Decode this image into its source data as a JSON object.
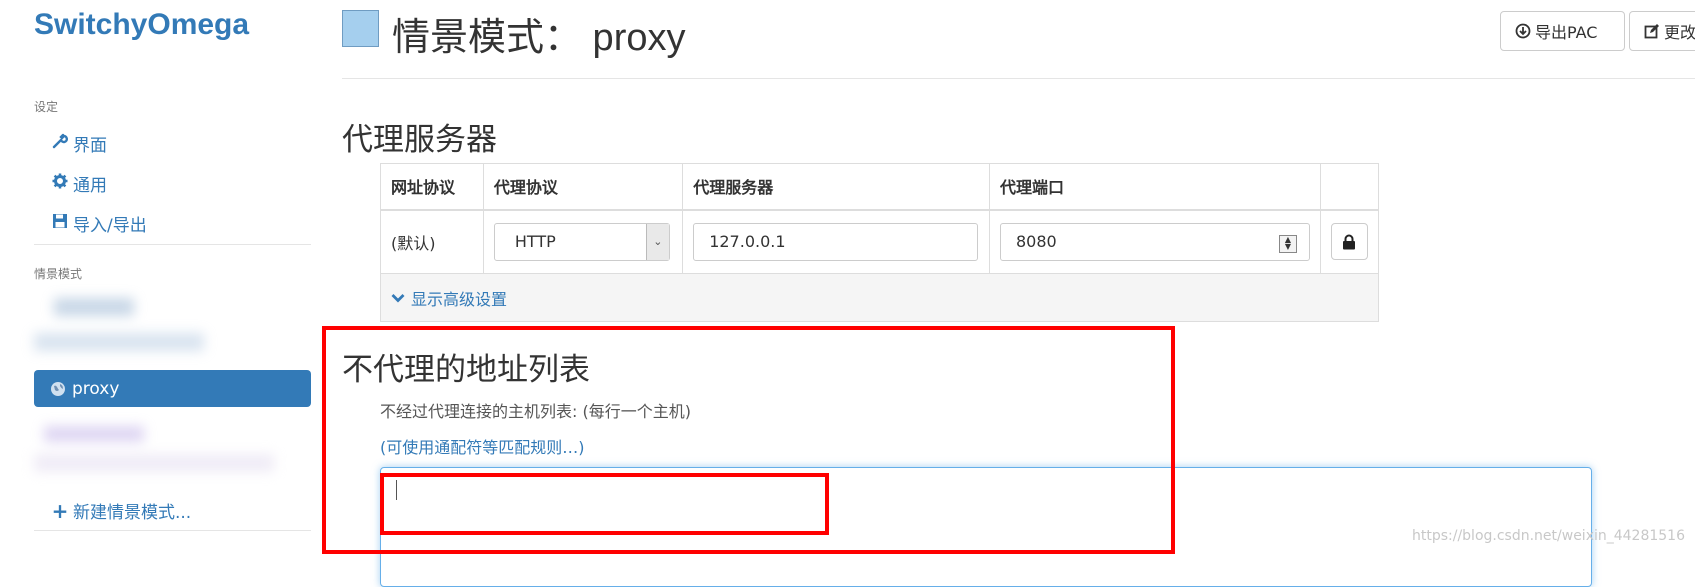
{
  "app": {
    "brand": "SwitchyOmega"
  },
  "sidebar": {
    "settings_header": "设定",
    "settings_items": [
      {
        "label": "界面",
        "icon": "wrench-icon"
      },
      {
        "label": "通用",
        "icon": "gear-icon"
      },
      {
        "label": "导入/导出",
        "icon": "floppy-icon"
      }
    ],
    "profiles_header": "情景模式",
    "active_profile": {
      "label": "proxy",
      "icon": "globe-icon"
    },
    "new_profile": {
      "label": "新建情景模式...",
      "icon": "plus-icon"
    }
  },
  "header": {
    "title": "情景模式： proxy",
    "profile_color": "#a5cfee",
    "export_pac_label": "导出PAC",
    "edit_label": "更改"
  },
  "proxy_servers": {
    "section_title": "代理服务器",
    "columns": [
      "网址协议",
      "代理协议",
      "代理服务器",
      "代理端口"
    ],
    "row": {
      "scheme": "(默认)",
      "protocol": "HTTP",
      "server": "127.0.0.1",
      "port": "8080"
    },
    "advanced_link": "显示高级设置"
  },
  "bypass": {
    "section_title": "不代理的地址列表",
    "description": "不经过代理连接的主机列表: (每行一个主机)",
    "wildcard_link": "(可使用通配符等匹配规则…)",
    "value": ""
  },
  "watermark": "https://blog.csdn.net/weixin_44281516",
  "colors": {
    "accent": "#337ab7",
    "highlight": "#ff0000"
  }
}
